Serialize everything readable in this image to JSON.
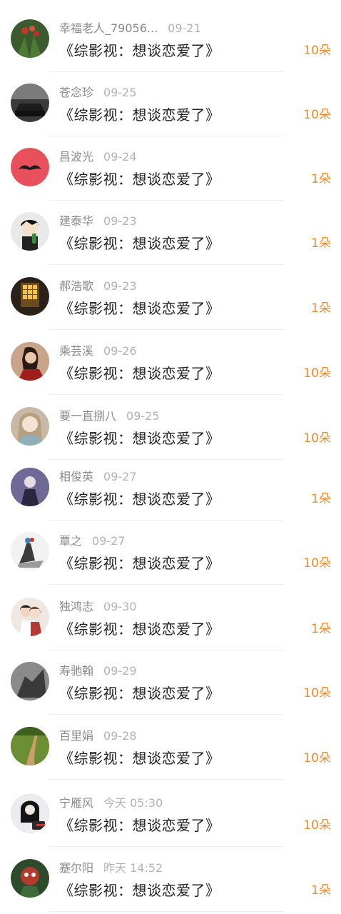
{
  "colors": {
    "gift_accent": "#f08a2c",
    "name_text": "#8a8a8a",
    "time_text": "#b3b3b3",
    "title_text": "#222222"
  },
  "gift_list": [
    {
      "name": "幸福老人_79056...",
      "time": "09-21",
      "title": "《综影视：想谈恋爱了》",
      "gift": "10朵",
      "avatar_icon": "flower-photo-avatar",
      "avatar_color": "#3b5a2e"
    },
    {
      "name": "苍念珍",
      "time": "09-25",
      "title": "《综影视：想谈恋爱了》",
      "gift": "10朵",
      "avatar_icon": "car-photo-avatar",
      "avatar_color": "#3a3a3a"
    },
    {
      "name": "昌波光",
      "time": "09-24",
      "title": "《综影视：想谈恋爱了》",
      "gift": "1朵",
      "avatar_icon": "mustache-avatar",
      "avatar_color": "#e8505b"
    },
    {
      "name": "建泰华",
      "time": "09-23",
      "title": "《综影视：想谈恋爱了》",
      "gift": "1朵",
      "avatar_icon": "cartoon-boy-avatar",
      "avatar_color": "#e9e9e9"
    },
    {
      "name": "郝浩歌",
      "time": "09-23",
      "title": "《综影视：想谈恋爱了》",
      "gift": "1朵",
      "avatar_icon": "night-window-avatar",
      "avatar_color": "#2a2218"
    },
    {
      "name": "乘芸溪",
      "time": "09-26",
      "title": "《综影视：想谈恋爱了》",
      "gift": "10朵",
      "avatar_icon": "woman-red-avatar",
      "avatar_color": "#8a2f25"
    },
    {
      "name": "要一直捌八",
      "time": "09-25",
      "title": "《综影视：想谈恋爱了》",
      "gift": "10朵",
      "avatar_icon": "anime-girl-avatar",
      "avatar_color": "#c9b8a6"
    },
    {
      "name": "相俊英",
      "time": "09-27",
      "title": "《综影视：想谈恋爱了》",
      "gift": "1朵",
      "avatar_icon": "purple-figure-avatar",
      "avatar_color": "#4d4a6b"
    },
    {
      "name": "覃之",
      "time": "09-27",
      "title": "《综影视：想谈恋爱了》",
      "gift": "10朵",
      "avatar_icon": "ink-figure-avatar",
      "avatar_color": "#f2f2f2"
    },
    {
      "name": "独鸿志",
      "time": "09-30",
      "title": "《综影视：想谈恋爱了》",
      "gift": "1朵",
      "avatar_icon": "couple-illustration-avatar",
      "avatar_color": "#efe7e1"
    },
    {
      "name": "寿驰翰",
      "time": "09-29",
      "title": "《综影视：想谈恋爱了》",
      "gift": "10朵",
      "avatar_icon": "grey-photo-avatar",
      "avatar_color": "#5a5a5a"
    },
    {
      "name": "百里娟",
      "time": "09-28",
      "title": "《综影视：想谈恋爱了》",
      "gift": "10朵",
      "avatar_icon": "green-path-avatar",
      "avatar_color": "#5c7a2a"
    },
    {
      "name": "宁雁风",
      "time": "今天 05:30",
      "title": "《综影视：想谈恋爱了》",
      "gift": "10朵",
      "avatar_icon": "dark-portrait-avatar",
      "avatar_color": "#1f1f26"
    },
    {
      "name": "蹇尔阳",
      "time": "昨天 14:52",
      "title": "《综影视：想谈恋爱了》",
      "gift": "1朵",
      "avatar_icon": "green-mask-avatar",
      "avatar_color": "#2d4a2a"
    }
  ]
}
